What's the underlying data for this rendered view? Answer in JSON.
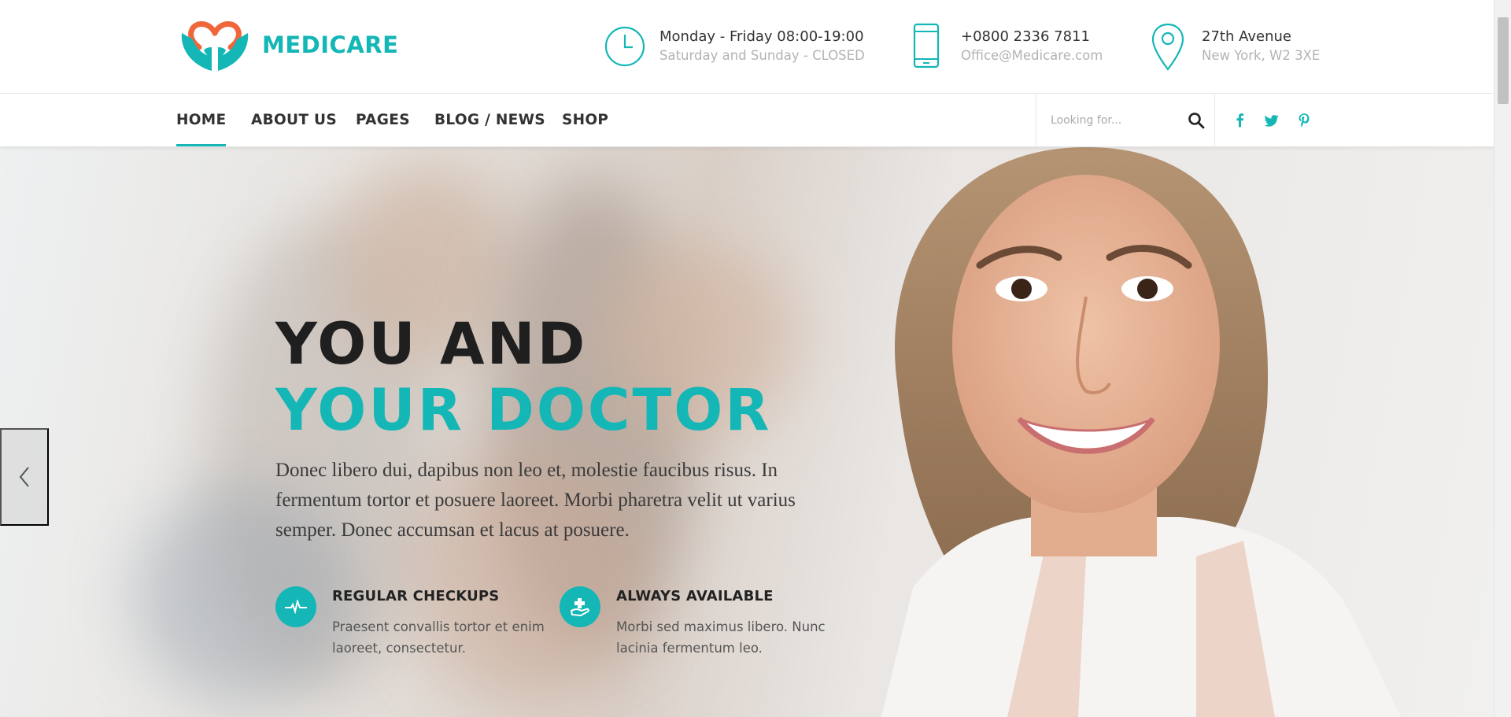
{
  "brand": {
    "name": "MEDICARE"
  },
  "header_info": [
    {
      "icon": "clock-icon",
      "line1": "Monday - Friday 08:00-19:00",
      "line2": "Saturday and Sunday - CLOSED"
    },
    {
      "icon": "phone-icon",
      "line1": "+0800 2336 7811",
      "line2": "Office@Medicare.com"
    },
    {
      "icon": "map-pin-icon",
      "line1": "27th Avenue",
      "line2": "New York, W2 3XE"
    }
  ],
  "nav": {
    "items": [
      {
        "label": "HOME",
        "active": true
      },
      {
        "label": "ABOUT US",
        "active": false
      },
      {
        "label": "PAGES",
        "active": false
      },
      {
        "label": "BLOG / NEWS",
        "active": false
      },
      {
        "label": "SHOP",
        "active": false
      }
    ],
    "search_placeholder": "Looking for...",
    "social": [
      "facebook-icon",
      "twitter-icon",
      "pinterest-icon"
    ]
  },
  "hero": {
    "title_line1": "YOU AND",
    "title_line2": "YOUR DOCTOR",
    "lead": "Donec libero dui, dapibus non leo et, molestie faucibus risus. In fermentum tortor et posuere laoreet. Morbi pharetra velit ut varius semper. Donec accumsan et lacus at posuere.",
    "features": [
      {
        "icon": "heartbeat-icon",
        "title": "REGULAR CHECKUPS",
        "text": "Praesent convallis tortor et enim laoreet, consectetur."
      },
      {
        "icon": "first-aid-hand-icon",
        "title": "ALWAYS AVAILABLE",
        "text": "Morbi sed maximus libero. Nunc lacinia fermentum leo."
      }
    ]
  },
  "colors": {
    "accent": "#14b6b6",
    "logo_heart": "#f0663a",
    "text_dark": "#222222",
    "text_muted": "#b3b3b3"
  }
}
